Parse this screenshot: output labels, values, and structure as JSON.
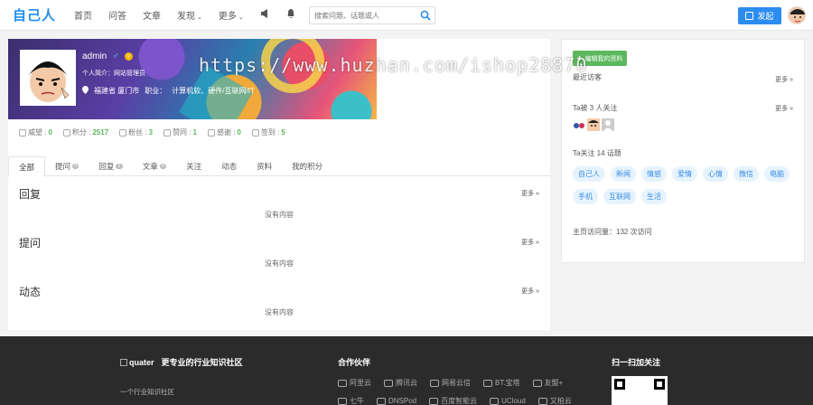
{
  "header": {
    "logo": "自己人",
    "nav": [
      {
        "label": "首页"
      },
      {
        "label": "问答"
      },
      {
        "label": "文章"
      },
      {
        "label": "发现",
        "caret": "⌄"
      },
      {
        "label": "更多",
        "caret": "⌄"
      }
    ],
    "search_placeholder": "搜索问题、话题或人",
    "post_label": "发起",
    "icons": [
      "megaphone-icon",
      "bell-icon",
      "search-icon",
      "avatar"
    ]
  },
  "watermark": "https://www.huzhan.com/ishop28870",
  "profile": {
    "username": "admin",
    "gender_symbol": "♂",
    "vip_badge": "V",
    "intro": "个人简介：网站管理员",
    "location": "福建省 厦门市",
    "job_label": "职业：",
    "job": "计算机软、硬件/互联网/IT",
    "stats": [
      {
        "label": "威望 :",
        "value": "0"
      },
      {
        "label": "积分 :",
        "value": "2517"
      },
      {
        "label": "粉丝 :",
        "value": "3"
      },
      {
        "label": "赞同 :",
        "value": "1"
      },
      {
        "label": "感谢 :",
        "value": "0"
      },
      {
        "label": "签到 :",
        "value": "5"
      }
    ]
  },
  "tabs": [
    {
      "label": "全部",
      "count": ""
    },
    {
      "label": "提问",
      "count": "0"
    },
    {
      "label": "回复",
      "count": "1"
    },
    {
      "label": "文章",
      "count": "0"
    },
    {
      "label": "关注",
      "count": ""
    },
    {
      "label": "动态",
      "count": ""
    },
    {
      "label": "资料",
      "count": ""
    },
    {
      "label": "我的积分",
      "count": ""
    }
  ],
  "sections": [
    {
      "title": "回复",
      "more": "更多 »",
      "empty": "没有内容"
    },
    {
      "title": "提问",
      "more": "更多 »",
      "empty": "没有内容"
    },
    {
      "title": "动态",
      "more": "更多 »",
      "empty": "没有内容"
    }
  ],
  "sidebar": {
    "edit_label": "编辑我的资料",
    "visitors_label": "最近访客",
    "more": "更多 »",
    "followers_label": "Ta被 3 人关注",
    "topics_label": "Ta关注 14 话题",
    "topics": [
      "自己人",
      "新闻",
      "情感",
      "爱情",
      "心情",
      "微信",
      "电脑",
      "手机",
      "互联网",
      "生活"
    ],
    "pageviews": "主页访问量：132 次访问"
  },
  "footer": {
    "brand_img": "quater",
    "brand_slogan": "更专业的行业知识社区",
    "sub": "一个行业知识社区",
    "partners_title": "合作伙伴",
    "partners_row1": [
      "阿里云",
      "腾讯云",
      "网易云信",
      "BT.宝塔",
      "友盟+"
    ],
    "partners_row2": [
      "七牛",
      "DNSPod",
      "百度智能云",
      "UCloud",
      "又拍云"
    ],
    "follow_title": "扫一扫加关注"
  },
  "colors": {
    "brand_blue": "#1f8ef1",
    "post_button": "#2d8cf0",
    "edit_button": "#5cb85c",
    "stat_value": "#5bb85d",
    "topic_bg": "#e6f3fd",
    "footer_bg": "#2b2b2b"
  }
}
